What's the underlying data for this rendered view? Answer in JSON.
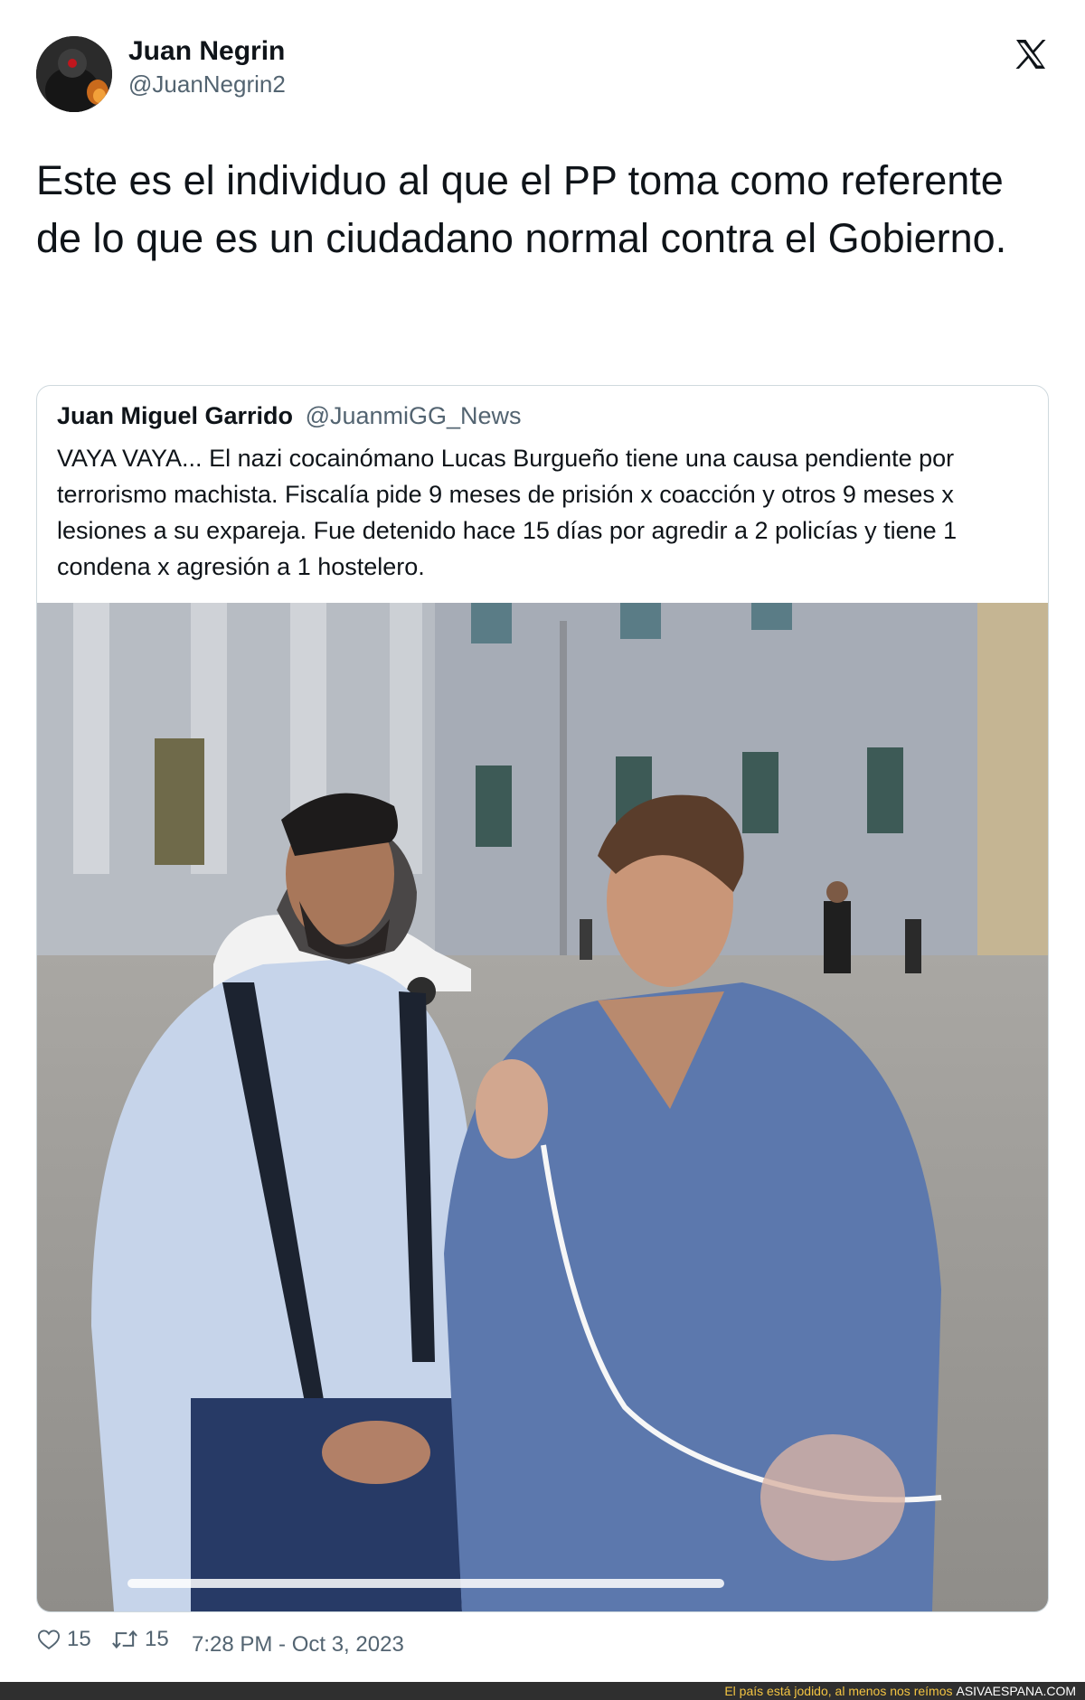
{
  "tweet": {
    "author": {
      "name": "Juan Negrin",
      "handle": "@JuanNegrin2"
    },
    "platform_icon": "x-logo-icon",
    "text": "Este es el individuo al que el PP toma como referente de lo que es un ciudadano normal contra el Gobierno.",
    "quoted": {
      "author": {
        "name": "Juan Miguel Garrido",
        "handle": "@JuanmiGG_News"
      },
      "text": "VAYA VAYA... El nazi cocainómano Lucas Burgueño tiene una causa pendiente por terrorismo machista. Fiscalía pide 9 meses de prisión x coacción y otros 9 meses x lesiones a su expareja. Fue detenido hace 15 días por agredir a 2 policías y tiene 1 condena x agresión a 1 hostelero.",
      "media_progress": 0.55
    },
    "metrics": {
      "likes": "15",
      "retweets": "15"
    },
    "timestamp": "7:28 PM - Oct 3, 2023"
  },
  "site_bar": {
    "slogan": "El país está jodido, al menos nos reímos",
    "site": "ASIVAESPANA.COM"
  },
  "colors": {
    "text": "#0f1419",
    "secondary": "#536471",
    "border": "#cfd9de",
    "bar_bg": "#2f2f2f",
    "bar_text": "#f3c442"
  }
}
